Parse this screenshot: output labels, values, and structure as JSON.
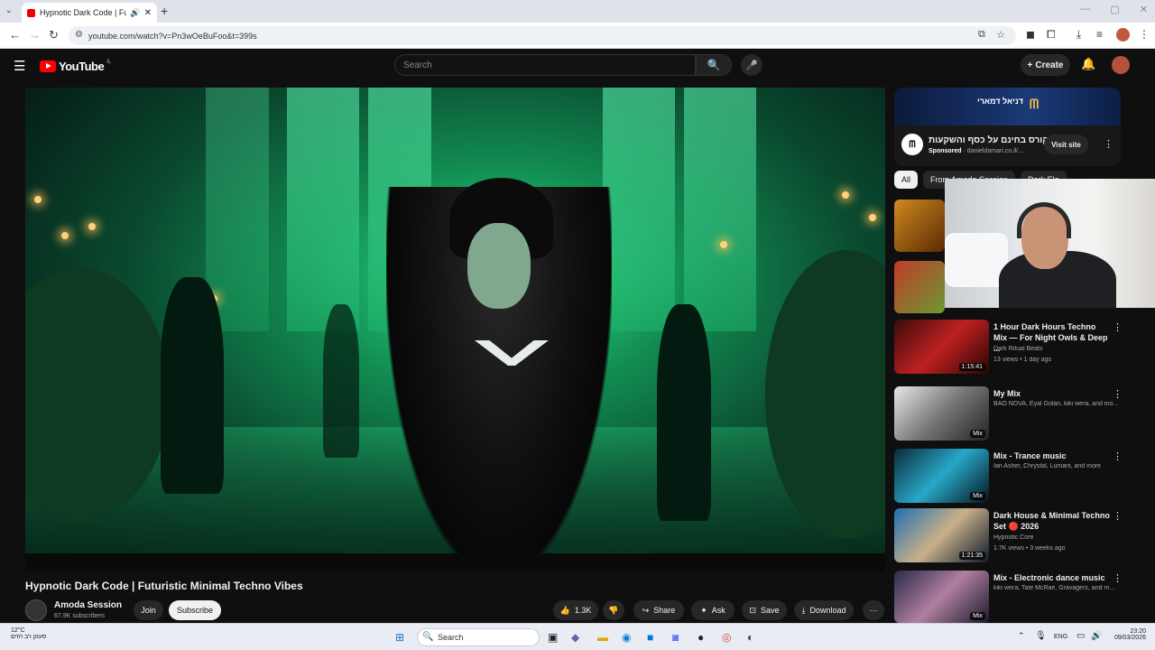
{
  "browser": {
    "tab_title": "Hypnotic Dark Code | Futur",
    "url": "youtube.com/watch?v=Pn3wOeBuFoo&t=399s"
  },
  "yt": {
    "logo_text": "YouTube",
    "logo_country": "IL",
    "search_placeholder": "Search",
    "create_label": "Create"
  },
  "video": {
    "title": "Hypnotic Dark Code | Futuristic Minimal Techno Vibes",
    "channel": "Amoda Session",
    "subscribers": "67.9K subscribers",
    "join_label": "Join",
    "subscribe_label": "Subscribe",
    "likes": "1.3K",
    "share_label": "Share",
    "ask_label": "Ask",
    "save_label": "Save",
    "download_label": "Download"
  },
  "ad": {
    "banner_text": "דניאל דמארי",
    "title": "קורס בחינם על כסף והשקעות",
    "sponsored": "Sponsored",
    "domain": "danieldamari.co.il/...",
    "visit_label": "Visit site"
  },
  "chips": [
    "All",
    "From Amoda Session",
    "Dark Ele"
  ],
  "recommendations": [
    {
      "title": "1 Hour Dark Hours Techno Mix — For Night Owls & Deep ...",
      "channel": "Dark Ritual Beats",
      "meta": "13 views • 1 day ago",
      "badge": "1:15:41"
    },
    {
      "title": "My Mix",
      "channel": "BAO NOVA, Eyal Golan, kiki wera, and mo...",
      "meta": "",
      "badge": "Mix"
    },
    {
      "title": "Mix - Trance music",
      "channel": "Ian Asher, Chrystal, Lumarii, and more",
      "meta": "",
      "badge": "Mix"
    },
    {
      "title": "Dark House & Minimal Techno Set 🔴 2026",
      "channel": "Hypnotic Core",
      "meta": "1.7K views • 3 weeks ago",
      "badge": "1:21:35"
    },
    {
      "title": "Mix - Electronic dance music",
      "channel": "kiki wera, Tate McRae, Gravagerz, and m...",
      "meta": "",
      "badge": "Mix"
    }
  ],
  "taskbar": {
    "weather_temp": "12°C",
    "weather_desc": "סעוק רב הזים",
    "search_label": "Search",
    "lang": "ENG",
    "time": "23:20",
    "date": "09/03/2026"
  }
}
